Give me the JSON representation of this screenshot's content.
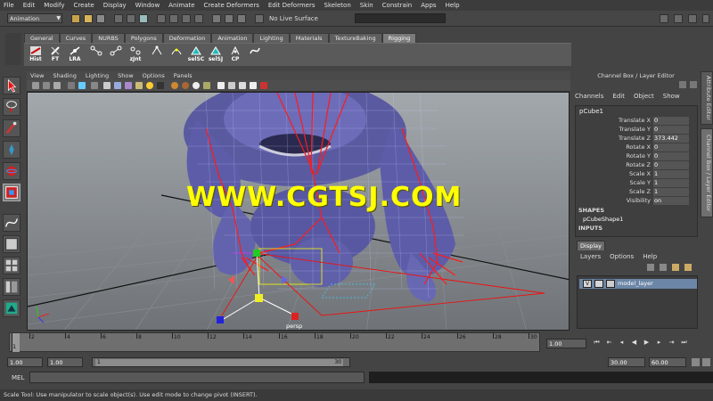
{
  "menubar": [
    "File",
    "Edit",
    "Modify",
    "Create",
    "Display",
    "Window",
    "Animate",
    "Create Deformers",
    "Edit Deformers",
    "Skeleton",
    "Skin",
    "Constrain",
    "Apps",
    "Help"
  ],
  "statusline": {
    "mode": "Animation",
    "live_surface": "No Live Surface"
  },
  "shelf": {
    "tabs": [
      "General",
      "Curves",
      "NURBS",
      "Polygons",
      "Deformation",
      "Animation",
      "Lighting",
      "Materials",
      "TextureBaking",
      "Rigging"
    ],
    "active_tab": "Rigging",
    "buttons": [
      "Hist",
      "FT",
      "LRA",
      "",
      "",
      "zJnt",
      "",
      "",
      "selSC",
      "selSJ",
      "CP",
      ""
    ]
  },
  "viewport": {
    "menus": [
      "View",
      "Shading",
      "Lighting",
      "Show",
      "Options",
      "Panels"
    ],
    "watermark": "WWW.CGTSJ.COM",
    "camera": "persp"
  },
  "right_panel": {
    "title": "Channel Box / Layer Editor",
    "menus": [
      "Channels",
      "Edit",
      "Object",
      "Show"
    ],
    "object": "pCube1",
    "channels": [
      {
        "name": "Translate X",
        "value": "0"
      },
      {
        "name": "Translate Y",
        "value": "0"
      },
      {
        "name": "Translate Z",
        "value": "373.442"
      },
      {
        "name": "Rotate X",
        "value": "0"
      },
      {
        "name": "Rotate Y",
        "value": "0"
      },
      {
        "name": "Rotate Z",
        "value": "0"
      },
      {
        "name": "Scale X",
        "value": "1"
      },
      {
        "name": "Scale Y",
        "value": "1"
      },
      {
        "name": "Scale Z",
        "value": "1"
      },
      {
        "name": "Visibility",
        "value": "on"
      }
    ],
    "shapes_label": "SHAPES",
    "shape": "pCubeShape1",
    "inputs_label": "INPUTS",
    "side_tabs": [
      "Attribute Editor",
      "Channel Box / Layer Editor"
    ],
    "layer_tab": "Display",
    "layer_menus": [
      "Layers",
      "Options",
      "Help"
    ],
    "layer": {
      "visible": "V",
      "name": "model_layer"
    }
  },
  "timeline": {
    "ticks": [
      "2",
      "4",
      "6",
      "8",
      "10",
      "12",
      "14",
      "16",
      "18",
      "20",
      "22",
      "24",
      "26",
      "28",
      "30"
    ],
    "current_frame": "1",
    "current_frame_field": "1.00"
  },
  "range": {
    "start": "1.00",
    "min": "1.00",
    "handle_start": "1",
    "handle_end": "30",
    "end": "30.00",
    "max": "60.00"
  },
  "command_line": {
    "label": "MEL"
  },
  "help_line": "Scale Tool: Use manipulator to scale object(s). Use edit mode to change pivot (INSERT)."
}
